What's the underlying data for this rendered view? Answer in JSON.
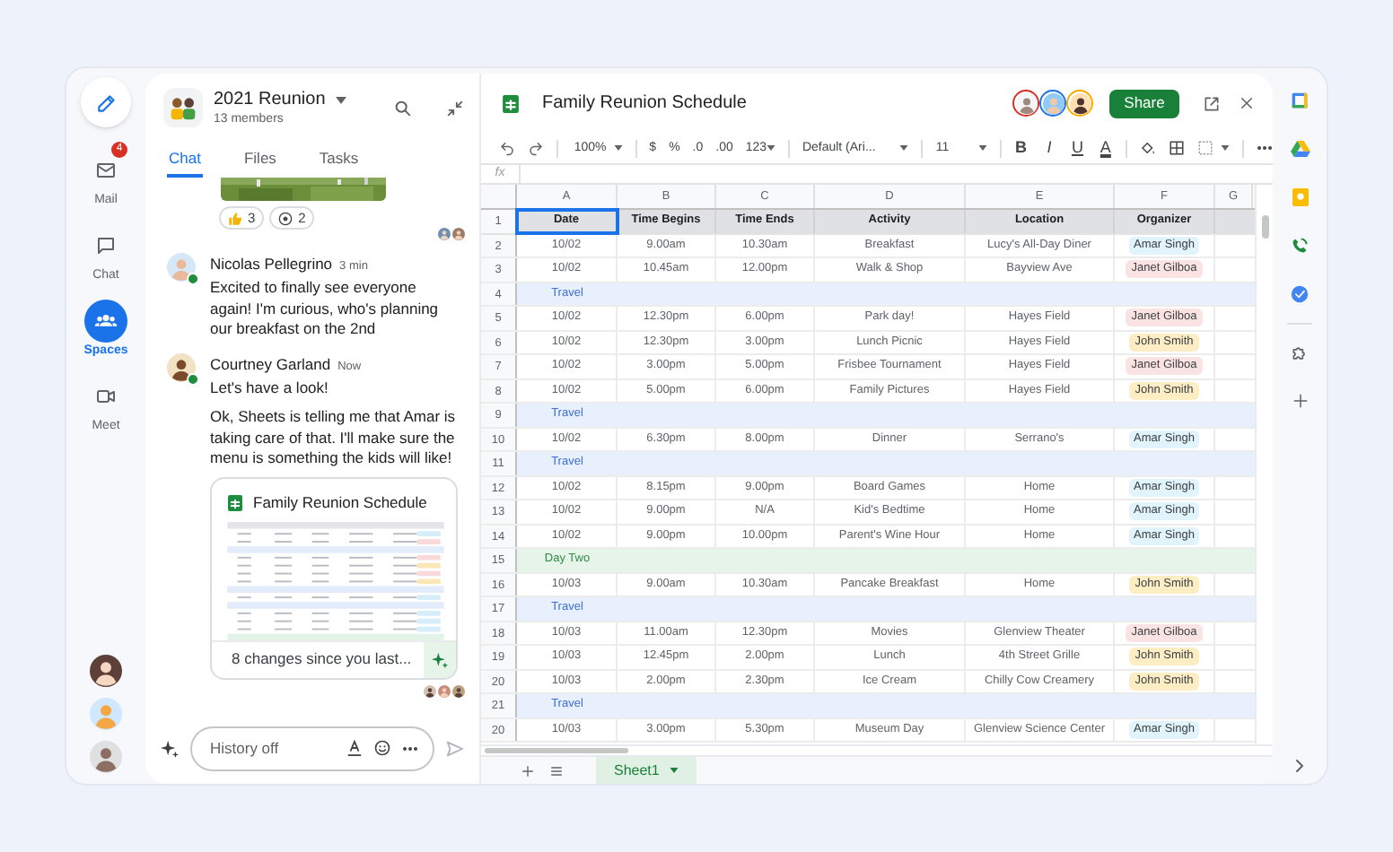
{
  "rail": {
    "items": [
      {
        "kind": "mail",
        "label": "Mail",
        "badge": "4",
        "selected": false
      },
      {
        "kind": "chat",
        "label": "Chat",
        "selected": false
      },
      {
        "kind": "spaces",
        "label": "Spaces",
        "selected": true
      },
      {
        "kind": "meet",
        "label": "Meet",
        "selected": false
      }
    ]
  },
  "chat": {
    "space_name": "2021 Reunion",
    "members": "13 members",
    "tabs": [
      {
        "label": "Chat",
        "selected": true
      },
      {
        "label": "Files",
        "selected": false
      },
      {
        "label": "Tasks",
        "selected": false
      }
    ],
    "reactions": [
      {
        "kind": "thumbs",
        "count": "3"
      },
      {
        "kind": "ball",
        "count": "2"
      }
    ],
    "messages": [
      {
        "author": "Nicolas Pellegrino",
        "time": "3 min",
        "online": true,
        "paragraphs": [
          "Excited to finally see everyone again! I'm curious, who's planning our breakfast on the 2nd"
        ]
      },
      {
        "author": "Courtney Garland",
        "time": "Now",
        "online": true,
        "paragraphs": [
          "Let's have a look!",
          "Ok, Sheets is telling me that Amar is taking care of that. I'll make sure the menu is something the kids will like!"
        ],
        "attachment": {
          "title": "Family Reunion Schedule",
          "summary": "8 changes since you last..."
        }
      }
    ],
    "composer": {
      "placeholder": "History off"
    }
  },
  "sheet": {
    "title": "Family Reunion Schedule",
    "share": "Share",
    "toolbar": {
      "zoom": "100%",
      "currency": "$",
      "percent": "%",
      "decrease_decimal": ".0",
      "increase_decimal": ".00",
      "number_format": "123",
      "font": "Default (Ari...",
      "font_size": "11",
      "format_buttons": [
        "B",
        "I",
        "U",
        "A"
      ]
    },
    "formula_label": "fx",
    "columns": [
      "A",
      "B",
      "C",
      "D",
      "E",
      "F",
      "G"
    ],
    "header_row": {
      "number": "1",
      "cells": [
        {
          "text": "Date",
          "selected": true
        },
        {
          "text": "Time Begins",
          "selected": false
        },
        {
          "text": "Time Ends",
          "selected": false
        },
        {
          "text": "Activity",
          "selected": false
        },
        {
          "text": "Location",
          "selected": false
        },
        {
          "text": "Organizer",
          "selected": false
        }
      ]
    },
    "rows": [
      {
        "number": "2",
        "kind": "event",
        "cells": [
          "10/02",
          "9.00am",
          "10.30am",
          "Breakfast",
          "Lucy's All-Day Diner"
        ],
        "organizer": {
          "name": "Amar Singh",
          "color": "#e1f4fb"
        }
      },
      {
        "number": "3",
        "kind": "event",
        "cells": [
          "10/02",
          "10.45am",
          "12.00pm",
          "Walk & Shop",
          "Bayview Ave"
        ],
        "organizer": {
          "name": "Janet Gilboa",
          "color": "#fbe3e3"
        }
      },
      {
        "number": "4",
        "kind": "travel",
        "label": "Travel"
      },
      {
        "number": "5",
        "kind": "event",
        "cells": [
          "10/02",
          "12.30pm",
          "6.00pm",
          "Park day!",
          "Hayes Field"
        ],
        "organizer": {
          "name": "Janet Gilboa",
          "color": "#fbe3e3"
        }
      },
      {
        "number": "6",
        "kind": "event",
        "cells": [
          "10/02",
          "12.30pm",
          "3.00pm",
          "Lunch Picnic",
          "Hayes Field"
        ],
        "organizer": {
          "name": "John Smith",
          "color": "#fdedc4"
        }
      },
      {
        "number": "7",
        "kind": "event",
        "cells": [
          "10/02",
          "3.00pm",
          "5.00pm",
          "Frisbee Tournament",
          "Hayes Field"
        ],
        "organizer": {
          "name": "Janet Gilboa",
          "color": "#fbe3e3"
        }
      },
      {
        "number": "8",
        "kind": "event",
        "cells": [
          "10/02",
          "5.00pm",
          "6.00pm",
          "Family Pictures",
          "Hayes Field"
        ],
        "organizer": {
          "name": "John Smith",
          "color": "#fdedc4"
        }
      },
      {
        "number": "9",
        "kind": "travel",
        "label": "Travel"
      },
      {
        "number": "10",
        "kind": "event",
        "cells": [
          "10/02",
          "6.30pm",
          "8.00pm",
          "Dinner",
          "Serrano's"
        ],
        "organizer": {
          "name": "Amar Singh",
          "color": "#e1f4fb"
        }
      },
      {
        "number": "11",
        "kind": "travel",
        "label": "Travel"
      },
      {
        "number": "12",
        "kind": "event",
        "cells": [
          "10/02",
          "8.15pm",
          "9.00pm",
          "Board Games",
          "Home"
        ],
        "organizer": {
          "name": "Amar Singh",
          "color": "#e1f4fb"
        }
      },
      {
        "number": "13",
        "kind": "event",
        "cells": [
          "10/02",
          "9.00pm",
          "N/A",
          "Kid's Bedtime",
          "Home"
        ],
        "organizer": {
          "name": "Amar Singh",
          "color": "#e1f4fb"
        }
      },
      {
        "number": "14",
        "kind": "event",
        "cells": [
          "10/02",
          "9.00pm",
          "10.00pm",
          "Parent's Wine Hour",
          "Home"
        ],
        "organizer": {
          "name": "Amar Singh",
          "color": "#e1f4fb"
        }
      },
      {
        "number": "15",
        "kind": "day",
        "label": "Day Two"
      },
      {
        "number": "16",
        "kind": "event",
        "cells": [
          "10/03",
          "9.00am",
          "10.30am",
          "Pancake Breakfast",
          "Home"
        ],
        "organizer": {
          "name": "John Smith",
          "color": "#fdedc4"
        }
      },
      {
        "number": "17",
        "kind": "travel",
        "label": "Travel"
      },
      {
        "number": "18",
        "kind": "event",
        "cells": [
          "10/03",
          "11.00am",
          "12.30pm",
          "Movies",
          "Glenview Theater"
        ],
        "organizer": {
          "name": "Janet Gilboa",
          "color": "#fbe3e3"
        }
      },
      {
        "number": "19",
        "kind": "event",
        "cells": [
          "10/03",
          "12.45pm",
          "2.00pm",
          "Lunch",
          "4th Street Grille"
        ],
        "organizer": {
          "name": "John Smith",
          "color": "#fdedc4"
        }
      },
      {
        "number": "20",
        "kind": "event",
        "cells": [
          "10/03",
          "2.00pm",
          "2.30pm",
          "Ice Cream",
          "Chilly Cow Creamery"
        ],
        "organizer": {
          "name": "John Smith",
          "color": "#fdedc4"
        }
      },
      {
        "number": "21",
        "kind": "travel",
        "label": "Travel"
      },
      {
        "number": "20",
        "kind": "event",
        "cells": [
          "10/03",
          "3.00pm",
          "5.30pm",
          "Museum Day",
          "Glenview Science Center"
        ],
        "organizer": {
          "name": "Amar Singh",
          "color": "#e1f4fb"
        }
      }
    ],
    "sheet_tabs": [
      {
        "label": "Sheet1",
        "selected": true
      }
    ]
  }
}
